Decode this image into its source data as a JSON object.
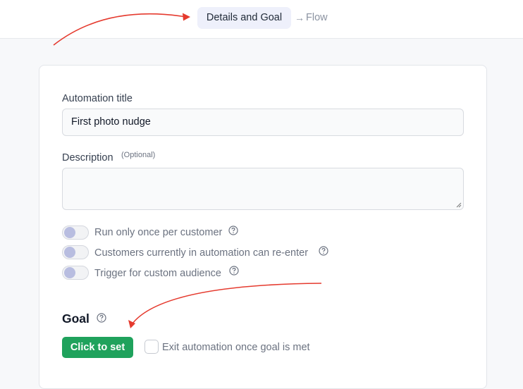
{
  "stepper": {
    "active_step": "Details and Goal",
    "arrow": "→",
    "next_step": "Flow"
  },
  "form": {
    "title_label": "Automation title",
    "title_value": "First photo nudge",
    "description_label": "Description",
    "description_optional": "(Optional)",
    "description_value": "",
    "toggles": [
      {
        "label": "Run only once per customer",
        "on": false
      },
      {
        "label": "Customers currently in automation can re-enter",
        "on": false
      },
      {
        "label": "Trigger for custom audience",
        "on": false
      }
    ]
  },
  "goal": {
    "title": "Goal",
    "set_button": "Click to set",
    "exit_checkbox_label": "Exit automation once goal is met",
    "exit_checked": false
  },
  "colors": {
    "annotation_arrow": "#e53a2e",
    "primary_button": "#1fa25c",
    "toggle_knob": "#b8bde0",
    "active_step_bg": "#eef0fb"
  }
}
